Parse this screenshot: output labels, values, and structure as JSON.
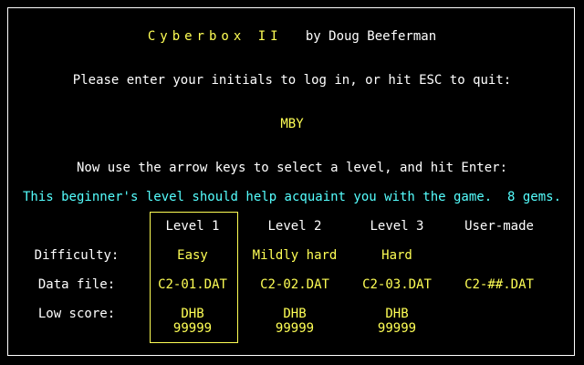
{
  "header": {
    "game_title": "Cyberbox II",
    "author": "by Doug Beeferman"
  },
  "login": {
    "prompt": "Please enter your initials to log in, or hit ESC to quit:",
    "initials": "MBY"
  },
  "level_select": {
    "instruction": "Now use the arrow keys to select a level, and hit Enter:",
    "description": "This beginner's level should help acquaint you with the game.  8 gems.",
    "selected_index": 0,
    "row_labels": {
      "difficulty": "Difficulty:",
      "data_file": "Data file:",
      "low_score": "Low score:"
    },
    "levels": [
      {
        "name": "Level 1",
        "difficulty": "Easy",
        "data_file": "C2-01.DAT",
        "low_score_initials": "DHB",
        "low_score": "99999"
      },
      {
        "name": "Level 2",
        "difficulty": "Mildly hard",
        "data_file": "C2-02.DAT",
        "low_score_initials": "DHB",
        "low_score": "99999"
      },
      {
        "name": "Level 3",
        "difficulty": "Hard",
        "data_file": "C2-03.DAT",
        "low_score_initials": "DHB",
        "low_score": "99999"
      },
      {
        "name": "User-made",
        "difficulty": "",
        "data_file": "C2-##.DAT",
        "low_score_initials": "",
        "low_score": ""
      }
    ]
  },
  "colors": {
    "background": "#000000",
    "text": "#ffffff",
    "highlight_yellow": "#ffff55",
    "description_cyan": "#55ffff"
  }
}
